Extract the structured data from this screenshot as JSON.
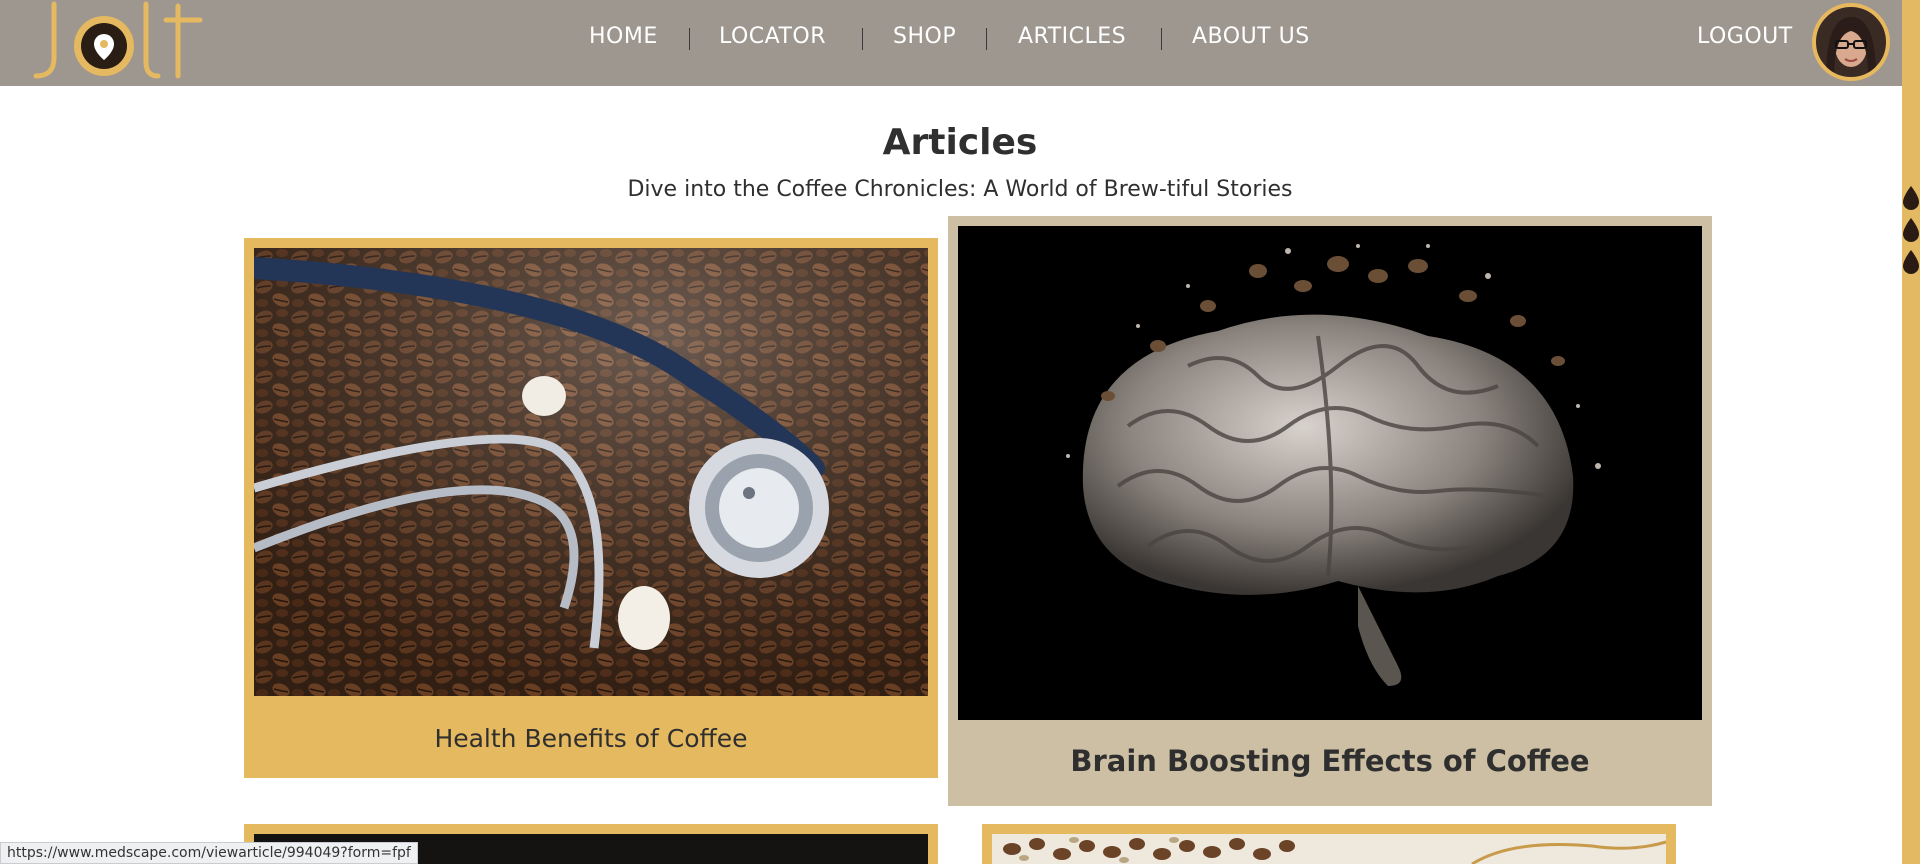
{
  "brand": {
    "logo_text": "Jolt"
  },
  "nav": {
    "items": [
      {
        "label": "HOME"
      },
      {
        "label": "LOCATOR"
      },
      {
        "label": "SHOP"
      },
      {
        "label": "ARTICLES"
      },
      {
        "label": "ABOUT US"
      }
    ],
    "logout_label": "LOGOUT"
  },
  "page": {
    "title": "Articles",
    "subtitle": "Dive into the Coffee Chronicles: A World of Brew-tiful Stories"
  },
  "articles": [
    {
      "title": "Health Benefits of Coffee",
      "image": "stethoscope-on-coffee-beans"
    },
    {
      "title": "Brain Boosting Effects of Coffee",
      "image": "coffee-brain"
    },
    {
      "title": "",
      "image": "dark-photo"
    },
    {
      "title": "",
      "image": "coffee-beans-photo"
    }
  ],
  "statusbar": {
    "url": "https://www.medscape.com/viewarticle/994049?form=fpf"
  },
  "colors": {
    "header": "#9e9790",
    "accent_gold": "#e5b95f",
    "card_tan": "#cdbfa3",
    "text": "#2f2f2f"
  }
}
